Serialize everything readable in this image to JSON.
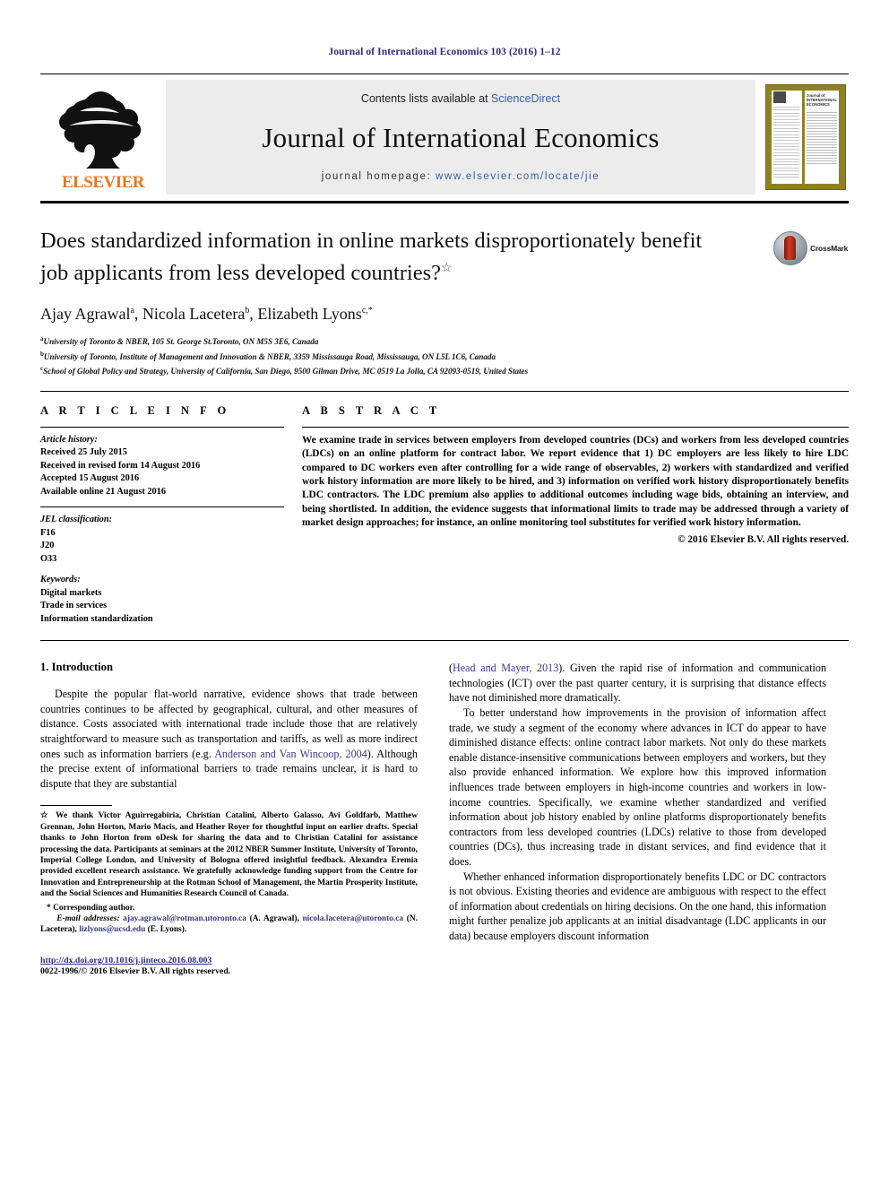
{
  "running_head": "Journal of International Economics 103 (2016) 1–12",
  "masthead": {
    "contents_prefix": "Contents lists available at",
    "contents_link": "ScienceDirect",
    "journal_title": "Journal of International Economics",
    "homepage_prefix": "journal homepage:",
    "homepage_url": "www.elsevier.com/locate/jie",
    "publisher_name": "ELSEVIER",
    "cover": {
      "masthead_small": "Journal of INTERNATIONAL ECONOMICS"
    }
  },
  "article": {
    "title": "Does standardized information in online markets disproportionately benefit job applicants from less developed countries?",
    "title_footnote_marker": "☆",
    "crossmark_label": "CrossMark",
    "authors_html": "Ajay Agrawal<sup>a</sup>, Nicola Lacetera<sup>b</sup>, Elizabeth Lyons<sup>c,*</sup>",
    "affiliations": [
      {
        "marker": "a",
        "text": "University of Toronto & NBER, 105 St. George St.Toronto, ON M5S 3E6, Canada"
      },
      {
        "marker": "b",
        "text": "University of Toronto, Institute of Management and Innovation & NBER, 3359 Mississauga Road, Mississauga, ON L5L 1C6, Canada"
      },
      {
        "marker": "c",
        "text": "School of Global Policy and Strategy, University of California, San Diego, 9500 Gilman Drive, MC 0519 La Jolla, CA 92093-0519, United States"
      }
    ]
  },
  "article_info": {
    "heading": "A R T I C L E   I N F O",
    "history_label": "Article history:",
    "history": [
      "Received 25 July 2015",
      "Received in revised form 14 August 2016",
      "Accepted 15 August 2016",
      "Available online 21 August 2016"
    ],
    "jel_label": "JEL classification:",
    "jel": [
      "F16",
      "J20",
      "O33"
    ],
    "keywords_label": "Keywords:",
    "keywords": [
      "Digital markets",
      "Trade in services",
      "Information standardization"
    ]
  },
  "abstract": {
    "heading": "A B S T R A C T",
    "text": "We examine trade in services between employers from developed countries (DCs) and workers from less developed countries (LDCs) on an online platform for contract labor. We report evidence that 1) DC employers are less likely to hire LDC compared to DC workers even after controlling for a wide range of observables, 2) workers with standardized and verified work history information are more likely to be hired, and 3) information on verified work history disproportionately benefits LDC contractors. The LDC premium also applies to additional outcomes including wage bids, obtaining an interview, and being shortlisted. In addition, the evidence suggests that informational limits to trade may be addressed through a variety of market design approaches; for instance, an online monitoring tool substitutes for verified work history information.",
    "copyright": "© 2016 Elsevier B.V. All rights reserved."
  },
  "body": {
    "section_heading": "1. Introduction",
    "left_paragraph_1_a": "Despite the popular flat-world narrative, evidence shows that trade between countries continues to be affected by geographical, cultural, and other measures of distance. Costs associated with international trade include those that are relatively straightforward to measure such as transportation and tariffs, as well as more indirect ones such as information barriers (e.g. ",
    "left_paragraph_1_link": "Anderson and Van Wincoop, 2004",
    "left_paragraph_1_b": "). Although the precise extent of informational barriers to trade remains unclear, it is hard to dispute that they are substantial",
    "right_paragraph_1_link": "Head and Mayer, 2013",
    "right_paragraph_1_a": "(",
    "right_paragraph_1_b": "). Given the rapid rise of information and communication technologies (ICT) over the past quarter century, it is surprising that distance effects have not diminished more dramatically.",
    "right_paragraph_2": "To better understand how improvements in the provision of information affect trade, we study a segment of the economy where advances in ICT do appear to have diminished distance effects: online contract labor markets. Not only do these markets enable distance-insensitive communications between employers and workers, but they also provide enhanced information. We explore how this improved information influences trade between employers in high-income countries and workers in low-income countries. Specifically, we examine whether standardized and verified information about job history enabled by online platforms disproportionately benefits contractors from less developed countries (LDCs) relative to those from developed countries (DCs), thus increasing trade in distant services, and find evidence that it does.",
    "right_paragraph_3": "Whether enhanced information disproportionately benefits LDC or DC contractors is not obvious. Existing theories and evidence are ambiguous with respect to the effect of information about credentials on hiring decisions. On the one hand, this information might further penalize job applicants at an initial disadvantage (LDC applicants in our data) because employers discount information"
  },
  "footnote": {
    "marker": "☆",
    "text": "We thank Victor Aguirregabiria, Christian Catalini, Alberto Galasso, Avi Goldfarb, Matthew Grennan, John Horton, Mario Macis, and Heather Royer for thoughtful input on earlier drafts. Special thanks to John Horton from oDesk for sharing the data and to Christian Catalini for assistance processing the data. Participants at seminars at the 2012 NBER Summer Institute, University of Toronto, Imperial College London, and University of Bologna offered insightful feedback. Alexandra Eremia provided excellent research assistance. We gratefully acknowledge funding support from the Centre for Innovation and Entrepreneurship at the Rotman School of Management, the Martin Prosperity Institute, and the Social Sciences and Humanities Research Council of Canada.",
    "corresponding_marker": "*",
    "corresponding_text": "Corresponding author.",
    "email_label": "E-mail addresses:",
    "emails": [
      {
        "address": "ajay.agrawal@rotman.utoronto.ca",
        "owner": "(A. Agrawal)"
      },
      {
        "address": "nicola.lacetera@utoronto.ca",
        "owner": "(N. Lacetera)"
      },
      {
        "address": "lizlyons@ucsd.edu",
        "owner": "(E. Lyons)"
      }
    ]
  },
  "doi_block": {
    "doi": "http://dx.doi.org/10.1016/j.jinteco.2016.08.003",
    "issn_line": "0022-1996/© 2016 Elsevier B.V. All rights reserved."
  },
  "colors": {
    "link": "#3a3a8c",
    "running_head": "#2b2b7f",
    "elsevier_orange": "#E87722",
    "cover_olive": "#8c8222"
  }
}
